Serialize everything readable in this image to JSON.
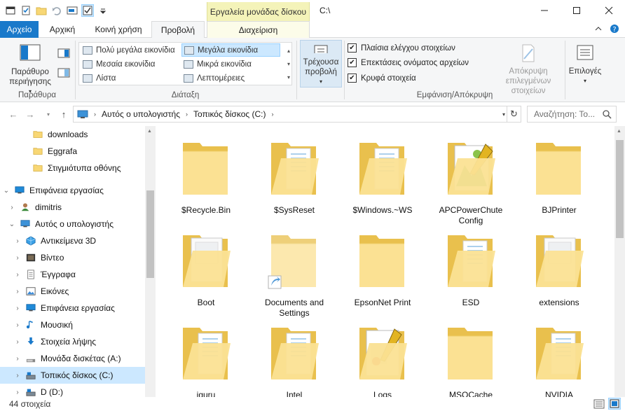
{
  "titlebar": {
    "context_tab_title": "Εργαλεία μονάδας δίσκου",
    "path": "C:\\",
    "qat_icons": [
      "properties-icon",
      "checkmark-doc-icon",
      "new-folder-icon",
      "undo-icon",
      "rename-icon",
      "checkbox-icon",
      "dropdown-icon"
    ]
  },
  "tabs": {
    "file": "Αρχείο",
    "home": "Αρχική",
    "share": "Κοινή χρήση",
    "view": "Προβολή",
    "manage": "Διαχείριση"
  },
  "ribbon": {
    "panes": {
      "navigation_pane": "Παράθυρο περιήγησης",
      "label": "Παράθυρα"
    },
    "layout": {
      "label": "Διάταξη",
      "options": [
        "Πολύ μεγάλα εικονίδια",
        "Μεγάλα εικονίδια",
        "Μεσαία εικονίδια",
        "Μικρά εικονίδια",
        "Λίστα",
        "Λεπτομέρειες"
      ],
      "selected": "Μεγάλα εικονίδια"
    },
    "current_view": "Τρέχουσα προβολή",
    "show_hide": {
      "label": "Εμφάνιση/Απόκρυψη",
      "item_checkboxes": "Πλαίσια ελέγχου στοιχείων",
      "file_extensions": "Επεκτάσεις ονόματος αρχείων",
      "hidden_items": "Κρυφά στοιχεία",
      "hide_selected": "Απόκρυψη επιλεγμένων στοιχείων",
      "item_checkboxes_checked": true,
      "file_extensions_checked": true,
      "hidden_items_checked": true
    },
    "options": "Επιλογές"
  },
  "address": {
    "crumbs": [
      "Αυτός ο υπολογιστής",
      "Τοπικός δίσκος (C:)"
    ],
    "search_placeholder": "Αναζήτηση: Το..."
  },
  "nav": {
    "items": [
      {
        "label": "downloads",
        "icon": "folder-icon",
        "level": 2
      },
      {
        "label": "Eggrafa",
        "icon": "folder-icon",
        "level": 2
      },
      {
        "label": "Στιγμιότυπα οθόνης",
        "icon": "folder-icon",
        "level": 2
      },
      {
        "label": "Επιφάνεια εργασίας",
        "icon": "desktop-icon",
        "level": 0
      },
      {
        "label": "dimitris",
        "icon": "user-icon",
        "level": 1
      },
      {
        "label": "Αυτός ο υπολογιστής",
        "icon": "computer-icon",
        "level": 1
      },
      {
        "label": "Αντικείμενα 3D",
        "icon": "3d-objects-icon",
        "level": 2
      },
      {
        "label": "Βίντεο",
        "icon": "video-icon",
        "level": 2
      },
      {
        "label": "Έγγραφα",
        "icon": "documents-icon",
        "level": 2
      },
      {
        "label": "Εικόνες",
        "icon": "pictures-icon",
        "level": 2
      },
      {
        "label": "Επιφάνεια εργασίας",
        "icon": "desktop-icon",
        "level": 2
      },
      {
        "label": "Μουσική",
        "icon": "music-icon",
        "level": 2
      },
      {
        "label": "Στοιχεία λήψης",
        "icon": "downloads-icon",
        "level": 2
      },
      {
        "label": "Μονάδα δισκέτας (A:)",
        "icon": "floppy-icon",
        "level": 2
      },
      {
        "label": "Τοπικός δίσκος (C:)",
        "icon": "drive-icon",
        "level": 2,
        "selected": true
      },
      {
        "label": "D (D:)",
        "icon": "drive-icon",
        "level": 2
      }
    ]
  },
  "files": [
    {
      "name": "$Recycle.Bin",
      "kind": "empty"
    },
    {
      "name": "$SysReset",
      "kind": "docs"
    },
    {
      "name": "$Windows.~WS",
      "kind": "docs"
    },
    {
      "name": "APCPowerChute Config",
      "kind": "image"
    },
    {
      "name": "BJPrinter",
      "kind": "empty"
    },
    {
      "name": "Boot",
      "kind": "pages"
    },
    {
      "name": "Documents and Settings",
      "kind": "shortcut"
    },
    {
      "name": "EpsonNet Print",
      "kind": "empty"
    },
    {
      "name": "ESD",
      "kind": "docs"
    },
    {
      "name": "extensions",
      "kind": "pages"
    },
    {
      "name": "iguru",
      "kind": "docs"
    },
    {
      "name": "Intel",
      "kind": "docs"
    },
    {
      "name": "Logs",
      "kind": "logs"
    },
    {
      "name": "MSOCache",
      "kind": "empty"
    },
    {
      "name": "NVIDIA",
      "kind": "docs"
    }
  ],
  "status": {
    "count": "44 στοιχεία"
  },
  "colors": {
    "accent": "#1979ca",
    "selection": "#cce8ff",
    "folder": "#f8d775",
    "context_tab": "#f4f3b9"
  }
}
